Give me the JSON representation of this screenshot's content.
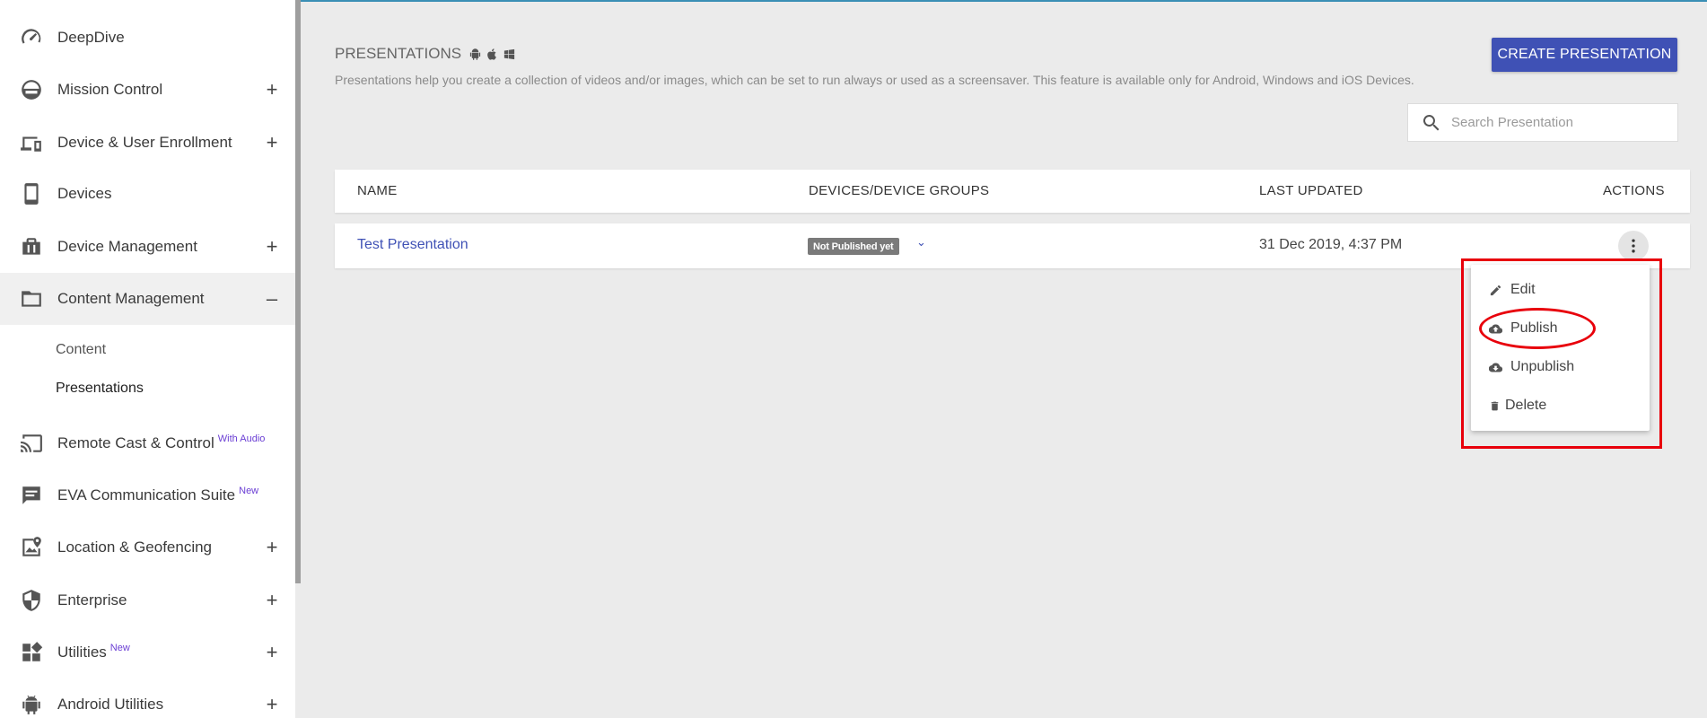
{
  "sidebar": {
    "items": [
      {
        "label": "DeepDive",
        "icon": "speedometer-icon",
        "toggle": "",
        "badge": ""
      },
      {
        "label": "Mission Control",
        "icon": "mission-control-icon",
        "toggle": "+",
        "badge": ""
      },
      {
        "label": "Device & User Enrollment",
        "icon": "devices-icon",
        "toggle": "+",
        "badge": ""
      },
      {
        "label": "Devices",
        "icon": "smartphone-icon",
        "toggle": "",
        "badge": ""
      },
      {
        "label": "Device Management",
        "icon": "briefcase-icon",
        "toggle": "+",
        "badge": ""
      },
      {
        "label": "Content Management",
        "icon": "folder-icon",
        "toggle": "–",
        "badge": ""
      },
      {
        "label": "Remote Cast & Control",
        "icon": "cast-icon",
        "toggle": "",
        "badge": "With Audio"
      },
      {
        "label": "EVA Communication Suite",
        "icon": "chat-icon",
        "toggle": "",
        "badge": "New"
      },
      {
        "label": "Location & Geofencing",
        "icon": "map-pin-icon",
        "toggle": "+",
        "badge": ""
      },
      {
        "label": "Enterprise",
        "icon": "shield-icon",
        "toggle": "+",
        "badge": ""
      },
      {
        "label": "Utilities",
        "icon": "widgets-icon",
        "toggle": "+",
        "badge": "New"
      },
      {
        "label": "Android Utilities",
        "icon": "android-icon",
        "toggle": "+",
        "badge": ""
      }
    ],
    "sub_items": [
      "Content",
      "Presentations"
    ]
  },
  "header": {
    "title": "PRESENTATIONS",
    "description": "Presentations help you create a collection of videos and/or images, which can be set to run always or used as a screensaver. This feature is available only for Android, Windows and iOS Devices.",
    "create_label": "CREATE PRESENTATION"
  },
  "search": {
    "placeholder": "Search Presentation"
  },
  "table": {
    "columns": [
      "NAME",
      "DEVICES/DEVICE GROUPS",
      "LAST UPDATED",
      "ACTIONS"
    ],
    "rows": [
      {
        "name": "Test Presentation",
        "status": "Not Published yet",
        "updated": "31 Dec 2019, 4:37 PM"
      }
    ]
  },
  "menu": {
    "items": [
      {
        "label": "Edit",
        "icon": "pencil-icon"
      },
      {
        "label": "Publish",
        "icon": "cloud-upload-icon"
      },
      {
        "label": "Unpublish",
        "icon": "cloud-download-icon"
      },
      {
        "label": "Delete",
        "icon": "trash-icon"
      }
    ]
  },
  "colors": {
    "primary": "#3f51b5",
    "annotation": "#e8000b",
    "badge_new": "#6b3fd4"
  }
}
